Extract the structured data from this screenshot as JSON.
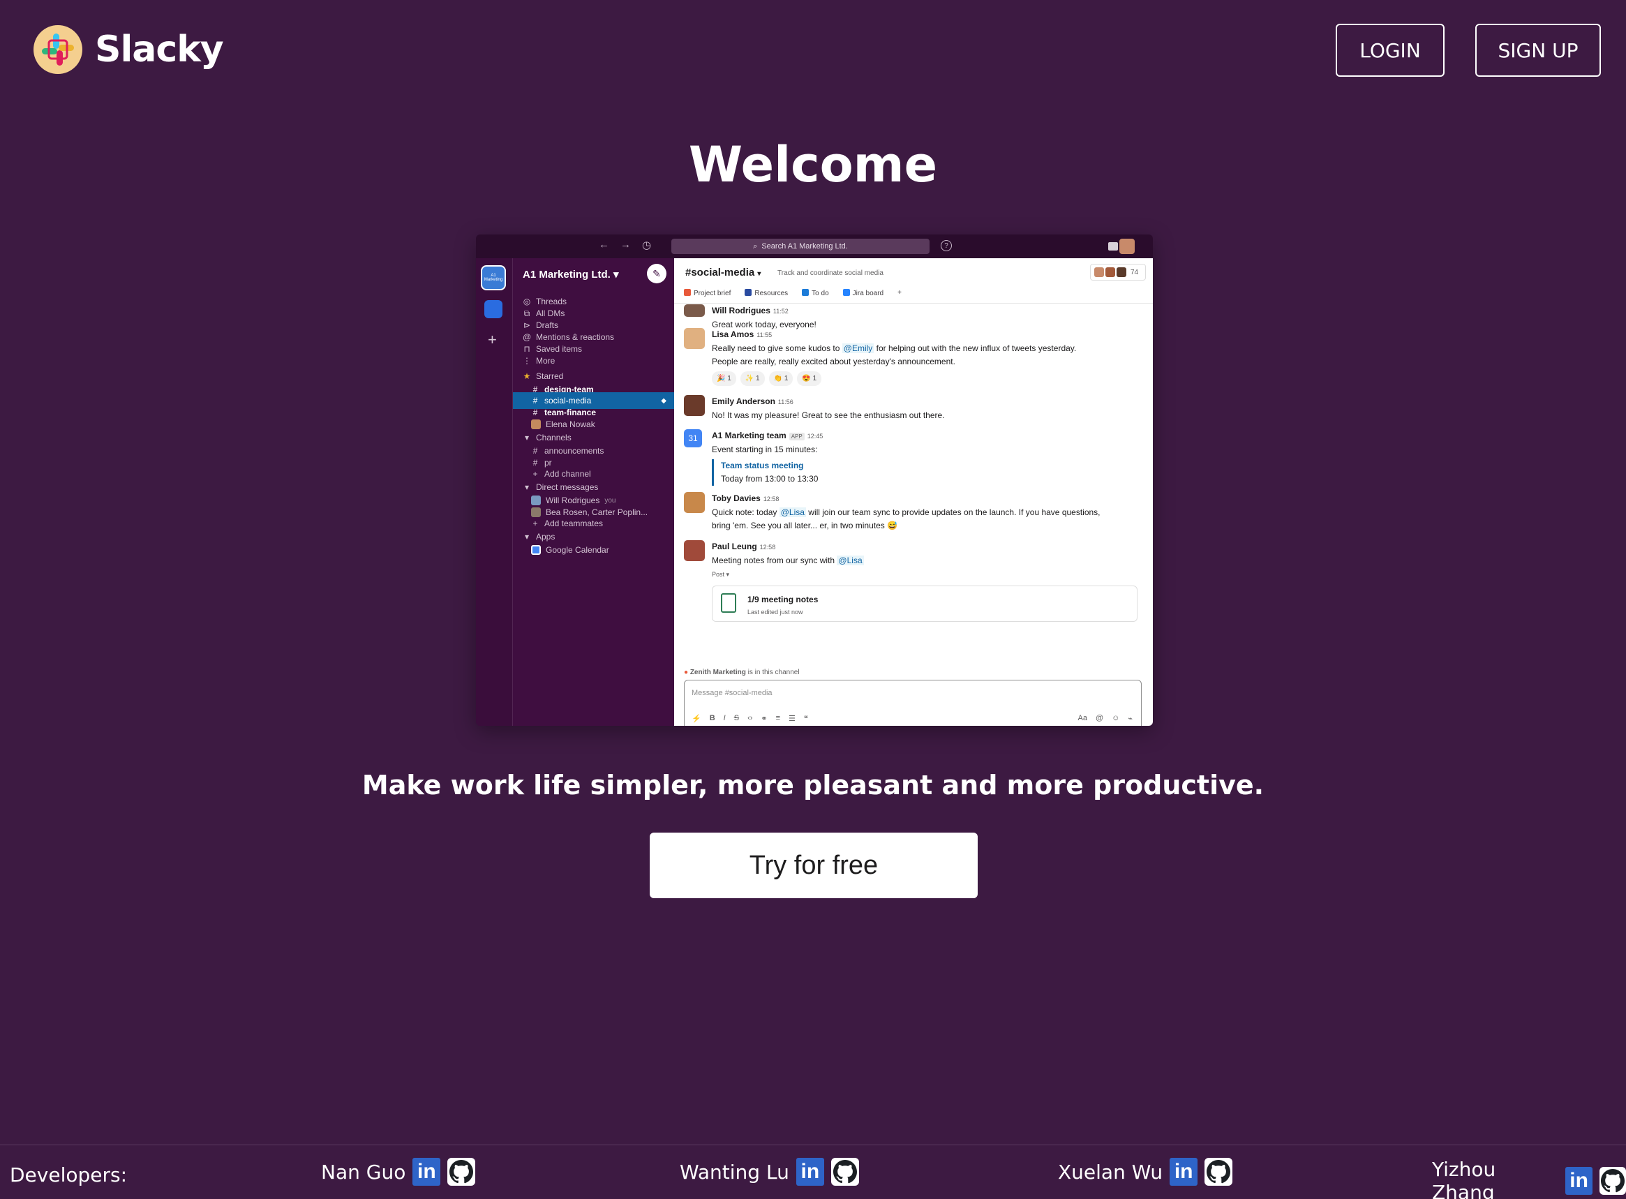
{
  "header": {
    "logo_text": "Slacky",
    "login_label": "LOGIN",
    "signup_label": "SIGN UP"
  },
  "hero": {
    "title": "Welcome",
    "tagline": "Make work life simpler, more pleasant and more productive.",
    "cta_label": "Try for free"
  },
  "preview": {
    "search_placeholder": "Search A1 Marketing Ltd.",
    "workspace_icon_text": "A1 Marketing",
    "workspace_name": "A1 Marketing Ltd.",
    "sidebar": {
      "threads": "Threads",
      "all_dms": "All DMs",
      "drafts": "Drafts",
      "mentions": "Mentions & reactions",
      "saved": "Saved items",
      "more": "More",
      "starred_header": "Starred",
      "starred": [
        "design-team",
        "social-media",
        "team-finance",
        "Elena Nowak"
      ],
      "channels_header": "Channels",
      "channels": [
        "announcements",
        "pr"
      ],
      "add_channel": "Add channel",
      "dms_header": "Direct messages",
      "dm_1": "Will Rodrigues",
      "dm_1_you": "you",
      "dm_2": "Bea Rosen, Carter Poplin...",
      "add_teammates": "Add teammates",
      "apps_header": "Apps",
      "app_1": "Google Calendar"
    },
    "channel": {
      "name": "#social-media",
      "description": "Track and coordinate social media",
      "member_count": "74",
      "tabs": [
        "Project brief",
        "Resources",
        "To do",
        "Jira board"
      ]
    },
    "messages": {
      "m1_who": "Will Rodrigues",
      "m1_time": "11:52",
      "m1_text": "Great work today, everyone!",
      "m2_who": "Lisa Amos",
      "m2_time": "11:55",
      "m2_text_a": "Really need to give some kudos to ",
      "m2_mention": "@Emily",
      "m2_text_b": " for helping out with the new influx of tweets yesterday.",
      "m2_text_c": "People are really, really excited about yesterday's announcement.",
      "m2_reacts": [
        "🎉 1",
        "✨ 1",
        "👏 1",
        "😍 1"
      ],
      "m3_who": "Emily Anderson",
      "m3_time": "11:56",
      "m3_text": "No! It was my pleasure! Great to see the enthusiasm out there.",
      "m4_who": "A1 Marketing team",
      "m4_badge": "APP",
      "m4_time": "12:45",
      "m4_text": "Event starting in 15 minutes:",
      "m4_event_title": "Team status meeting",
      "m4_event_time": "Today from 13:00 to 13:30",
      "m5_who": "Toby Davies",
      "m5_time": "12:58",
      "m5_text_a": "Quick note: today ",
      "m5_mention": "@Lisa",
      "m5_text_b": " will join our team sync to provide updates on the launch. If you have questions,",
      "m5_text_c": "bring 'em. See you all later... er, in two minutes 😅",
      "m6_who": "Paul Leung",
      "m6_time": "12:58",
      "m6_text_a": "Meeting notes from our sync with ",
      "m6_mention": "@Lisa",
      "m6_post_label": "Post ▾",
      "m6_post_title": "1/9 meeting notes",
      "m6_post_sub": "Last edited just now"
    },
    "in_channel_name": "Zenith Marketing",
    "in_channel_suffix": " is in this channel",
    "composer_placeholder": "Message #social-media"
  },
  "footer": {
    "label": "Developers:",
    "developers": [
      "Nan Guo",
      "Wanting Lu",
      "Xuelan Wu",
      "Yizhou Zhang"
    ]
  },
  "colors": {
    "page_bg": "#3d1a42",
    "sidebar_bg": "#3f0e40",
    "active_channel": "#1164a3",
    "linkedin_blue": "#2e64c8"
  }
}
